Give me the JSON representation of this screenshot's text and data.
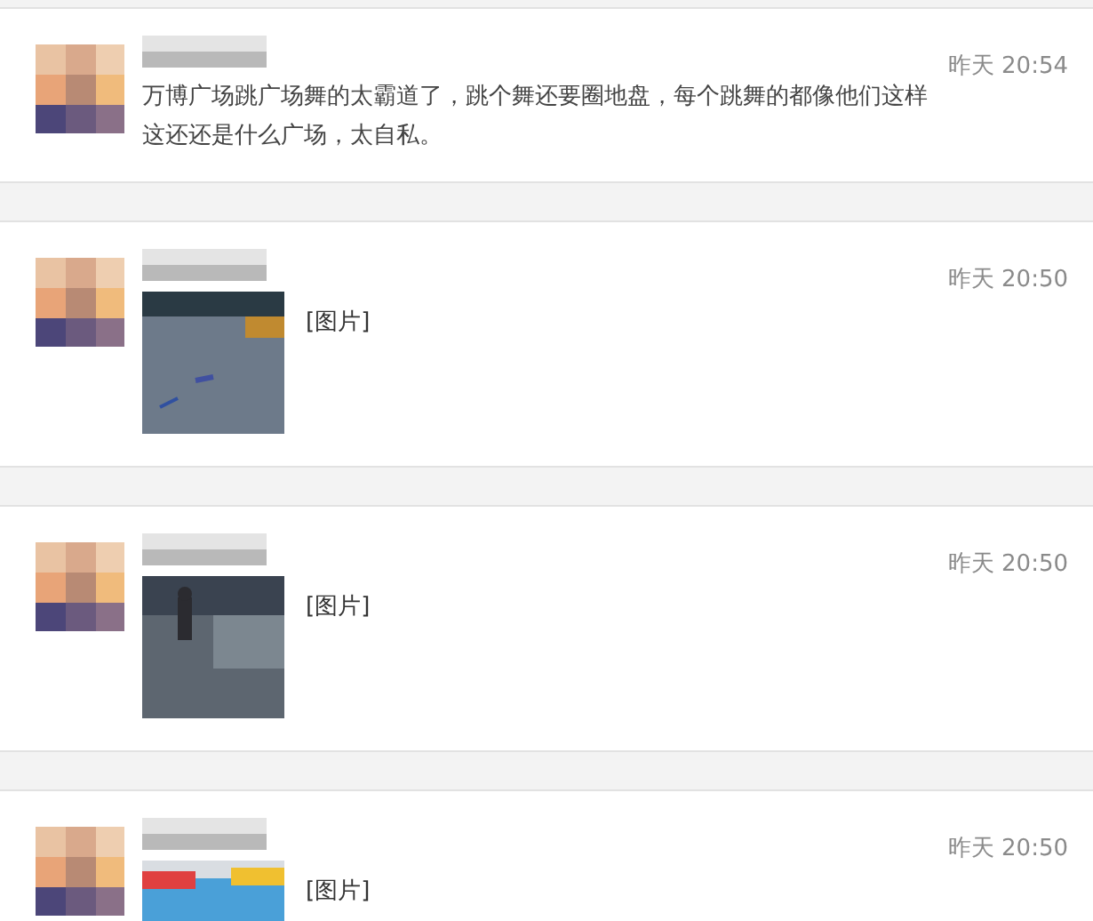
{
  "comments": [
    {
      "kind": "text",
      "time": "昨天 20:54",
      "text": "万博广场跳广场舞的太霸道了，跳个舞还要圈地盘，每个跳舞的都像他们这样这还还是什么广场，太自私。"
    },
    {
      "time": "昨天 20:50",
      "text": "[图片]"
    },
    {
      "time": "昨天 20:50",
      "text": "[图片]"
    },
    {
      "time": "昨天 20:50",
      "text": "[图片]"
    }
  ]
}
